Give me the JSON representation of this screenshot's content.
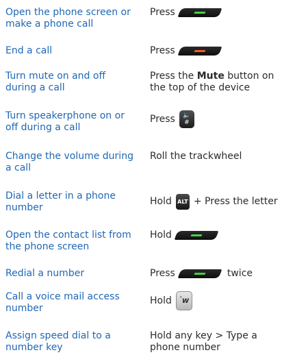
{
  "colors": {
    "task_text": "#1f67b4",
    "action_text": "#2b2b2b",
    "send_key_accent": "#48d04a",
    "end_key_accent": "#f05a2c"
  },
  "rows": [
    {
      "task": "Open the phone screen or make a phone call",
      "action_prefix": "Press",
      "icon": "send-key-icon"
    },
    {
      "task": "End a call",
      "action_prefix": "Press",
      "icon": "end-key-icon"
    },
    {
      "task": "Turn mute on and off during a call",
      "action_prefix": "Press the",
      "action_bold": "Mute",
      "action_suffix": "button on the top of the device"
    },
    {
      "task": "Turn speakerphone on or off during a call",
      "action_prefix": "Press",
      "icon": "speakerphone-key-icon",
      "icon_text_top": "🔈",
      "icon_text_bottom": "#"
    },
    {
      "task": "Change the volume during a call",
      "action_text": "Roll the trackwheel"
    },
    {
      "task": "Dial a letter in a phone number",
      "action_prefix": "Hold",
      "icon": "alt-key-icon",
      "icon_text": "ALT",
      "action_suffix": "+ Press the letter"
    },
    {
      "task": "Open the contact list from the phone screen",
      "action_prefix": "Hold",
      "icon": "send-key-icon"
    },
    {
      "task": "Redial a number",
      "action_prefix": "Press",
      "icon": "send-key-icon",
      "action_suffix": "twice"
    },
    {
      "task": "Call a voice mail access number",
      "action_prefix": "Hold",
      "icon": "voicemail-w-key-icon",
      "icon_text_top": "'",
      "icon_text_bottom": "W"
    },
    {
      "task": "Assign speed dial to a number key",
      "action_text": "Hold any key > Type a phone number"
    }
  ]
}
